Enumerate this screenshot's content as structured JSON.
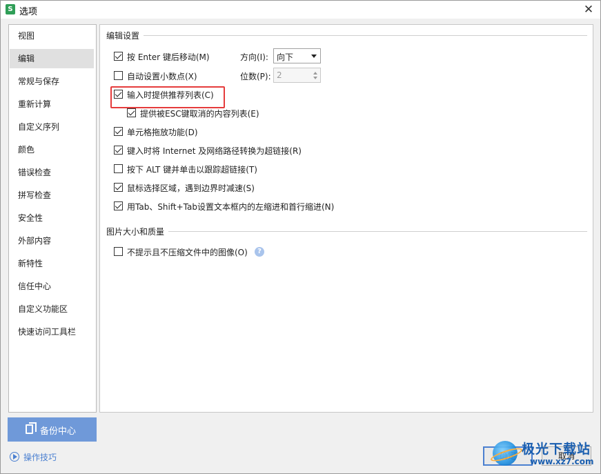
{
  "window": {
    "title": "选项",
    "app_icon_letter": "S",
    "close_label": "✕"
  },
  "sidebar": {
    "items": [
      {
        "label": "视图",
        "selected": false
      },
      {
        "label": "编辑",
        "selected": true
      },
      {
        "label": "常规与保存",
        "selected": false
      },
      {
        "label": "重新计算",
        "selected": false
      },
      {
        "label": "自定义序列",
        "selected": false
      },
      {
        "label": "颜色",
        "selected": false
      },
      {
        "label": "错误检查",
        "selected": false
      },
      {
        "label": "拼写检查",
        "selected": false
      },
      {
        "label": "安全性",
        "selected": false
      },
      {
        "label": "外部内容",
        "selected": false
      },
      {
        "label": "新特性",
        "selected": false
      },
      {
        "label": "信任中心",
        "selected": false
      },
      {
        "label": "自定义功能区",
        "selected": false
      },
      {
        "label": "快速访问工具栏",
        "selected": false
      }
    ],
    "backup_label": "备份中心",
    "tips_label": "操作技巧"
  },
  "edit_settings": {
    "group_title": "编辑设置",
    "options": [
      {
        "label": "按 Enter 键后移动(M)",
        "checked": true
      },
      {
        "label": "自动设置小数点(X)",
        "checked": false
      },
      {
        "label": "输入时提供推荐列表(C)",
        "checked": true,
        "highlighted": true
      },
      {
        "label": "提供被ESC键取消的内容列表(E)",
        "checked": true
      },
      {
        "label": "单元格拖放功能(D)",
        "checked": true
      },
      {
        "label": "键入时将 Internet 及网络路径转换为超链接(R)",
        "checked": true
      },
      {
        "label": "按下 ALT 键并单击以跟踪超链接(T)",
        "checked": false
      },
      {
        "label": "鼠标选择区域，遇到边界时减速(S)",
        "checked": true
      },
      {
        "label": "用Tab、Shift+Tab设置文本框内的左缩进和首行缩进(N)",
        "checked": true
      }
    ],
    "direction_label": "方向(I):",
    "direction_value": "向下",
    "decimal_label": "位数(P):",
    "decimal_value": "2"
  },
  "image_settings": {
    "group_title": "图片大小和质量",
    "options": [
      {
        "label": "不提示且不压缩文件中的图像(O)",
        "checked": false
      }
    ],
    "help_icon": "?"
  },
  "footer": {
    "ok_label": "确定",
    "cancel_label": "取消"
  },
  "watermark": {
    "text": "极光下载站",
    "url": "www.xz7.com"
  },
  "colors": {
    "accent": "#4a7fd0",
    "backup_button": "#6f99d9",
    "highlight_box": "#e53b3b"
  }
}
